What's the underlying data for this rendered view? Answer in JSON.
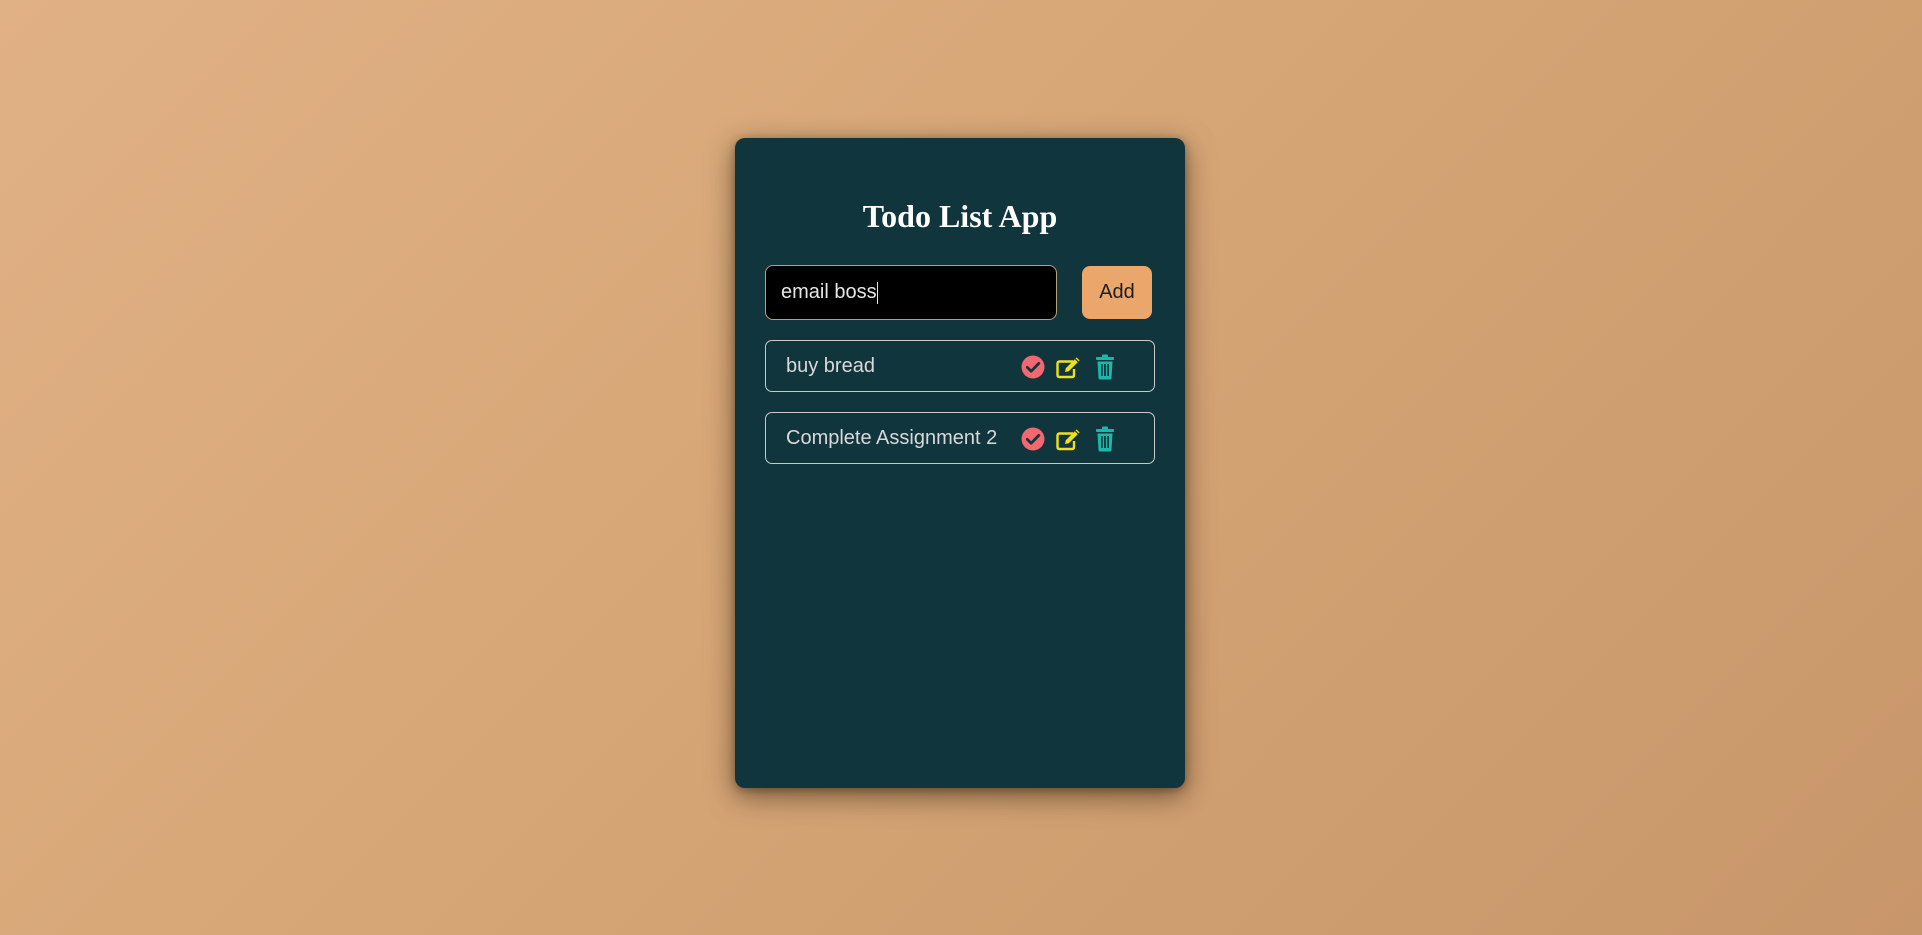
{
  "app": {
    "title": "Todo List App"
  },
  "input": {
    "value": "email boss",
    "add_label": "Add"
  },
  "todos": [
    {
      "text": "buy bread"
    },
    {
      "text": "Complete Assignment 2"
    }
  ],
  "icons": {
    "complete": "check-circle-icon",
    "edit": "pencil-square-icon",
    "delete": "trash-icon"
  },
  "colors": {
    "background_start": "#e0b185",
    "background_end": "#c7966a",
    "card": "#11353d",
    "add_button": "#eba66c",
    "complete_icon": "#f16870",
    "edit_icon": "#f0e020",
    "delete_icon": "#18b9a8"
  }
}
